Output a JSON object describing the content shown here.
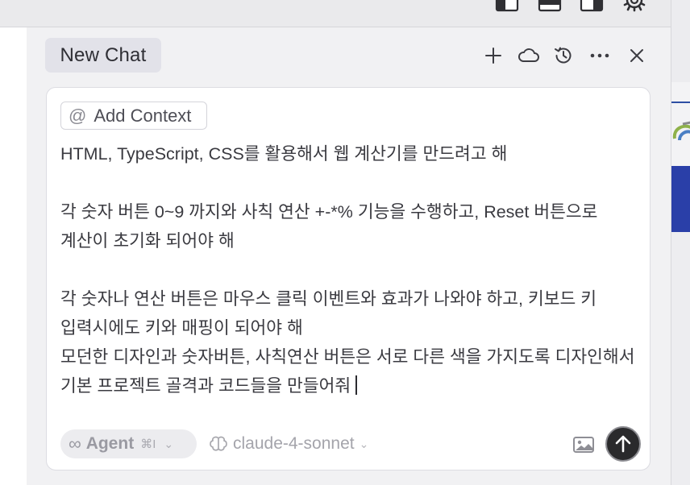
{
  "panel": {
    "tab_title": "New Chat",
    "header_icons": [
      "plus-icon",
      "cloud-icon",
      "history-icon",
      "more-icon",
      "close-icon"
    ]
  },
  "composer": {
    "context_chip": {
      "icon": "at-icon",
      "label": "Add Context"
    },
    "message": "HTML, TypeScript, CSS를 활용해서 웹 계산기를 만드려고 해\n\n각 숫자 버튼 0~9 까지와 사칙 연산 +-*% 기능을 수행하고, Reset 버튼으로 계산이 초기화 되어야 해\n\n각 숫자나 연산 버튼은 마우스 클릭 이벤트와 효과가 나와야 하고, 키보드 키 입력시에도 키와 매핑이 되어야 해\n모던한 디자인과 숫자버튼, 사칙연산 버튼은 서로 다른 색을 가지도록 디자인해서 기본 프로젝트 골격과 코드들을 만들어줘",
    "agent_mode": {
      "icon": "infinity-icon",
      "label": "Agent",
      "shortcut": "⌘I"
    },
    "model": {
      "icon": "brain-icon",
      "label": "claude-4-sonnet"
    }
  },
  "colors": {
    "panel_bg": "#f1f1f3",
    "composer_bg": "#ffffff",
    "send_button": "#2a2a2c",
    "tab_bg": "#e2e2e9"
  }
}
